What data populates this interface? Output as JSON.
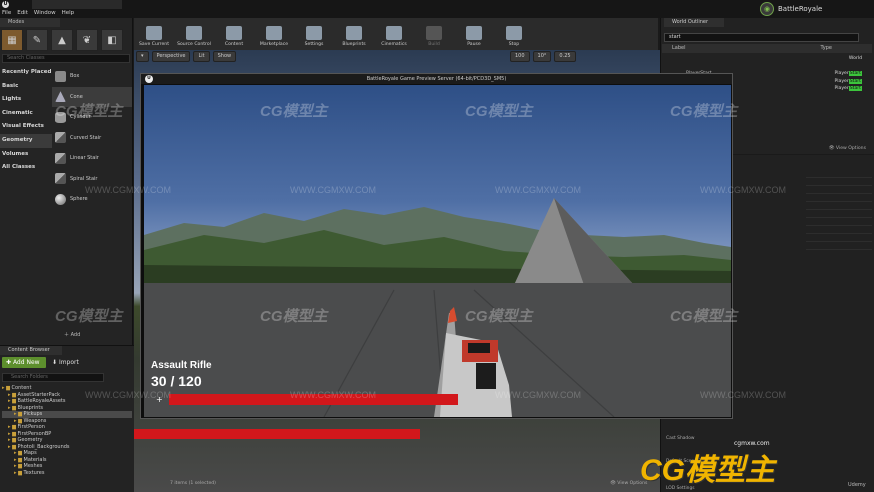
{
  "window": {
    "doc_tab": "",
    "menu": [
      "File",
      "Edit",
      "Window",
      "Help"
    ],
    "project_name": "BattleRoyale"
  },
  "modes": {
    "tab": "Modes",
    "search_placeholder": "Search Classes",
    "categories": [
      "Recently Placed",
      "Basic",
      "Lights",
      "Cinematic",
      "Visual Effects",
      "Geometry",
      "Volumes",
      "All Classes"
    ],
    "selected_category": "Geometry",
    "placeables": [
      "Box",
      "Cone",
      "Cylinder",
      "Curved Stair",
      "Linear Stair",
      "Spiral Stair",
      "Sphere"
    ],
    "selected_placeable": "Cone",
    "add_label": "Add"
  },
  "toolbar": {
    "items": [
      {
        "label": "Save Current",
        "icon": "save-icon"
      },
      {
        "label": "Source Control",
        "icon": "source-control-icon"
      },
      {
        "label": "Content",
        "icon": "content-icon"
      },
      {
        "label": "Marketplace",
        "icon": "marketplace-icon"
      },
      {
        "label": "Settings",
        "icon": "settings-icon"
      },
      {
        "label": "Blueprints",
        "icon": "blueprints-icon"
      },
      {
        "label": "Cinematics",
        "icon": "cinematics-icon"
      },
      {
        "label": "Build",
        "icon": "build-icon"
      },
      {
        "label": "Pause",
        "icon": "pause-icon"
      },
      {
        "label": "Stop",
        "icon": "stop-icon"
      }
    ]
  },
  "viewport": {
    "perspective": "Perspective",
    "lit": "Lit",
    "show": "Show",
    "snap_values": [
      "100",
      "10°",
      "0.25"
    ]
  },
  "outliner": {
    "tab": "World Outliner",
    "search_value": "start",
    "col_label": "Label",
    "col_type": "Type",
    "rows": [
      {
        "label": "",
        "type": "World",
        "indent": false
      },
      {
        "label": "",
        "type": "",
        "indent": false
      },
      {
        "label": "PlayerStart",
        "type": "PlayerStart",
        "indent": true
      },
      {
        "label": "",
        "type": "PlayerStart",
        "indent": true
      },
      {
        "label": "",
        "type": "PlayerStart",
        "indent": true
      }
    ],
    "view_options": "View Options"
  },
  "details": {
    "label_a": "Cast Shadow",
    "label_b": "Default Scene Root",
    "label_c": "LOD Settings",
    "credit": "Udemy"
  },
  "content_browser": {
    "tab": "Content Browser",
    "add_new": "Add New",
    "import": "Import",
    "search_placeholder": "Search Folders",
    "tree": [
      {
        "label": "Content",
        "level": 0,
        "selected": false
      },
      {
        "label": "AssetStarterPack",
        "level": 1,
        "selected": false
      },
      {
        "label": "BattleRoyaleAssets",
        "level": 1,
        "selected": false
      },
      {
        "label": "Blueprints",
        "level": 1,
        "selected": false
      },
      {
        "label": "Pickups",
        "level": 2,
        "selected": true
      },
      {
        "label": "Weapons",
        "level": 2,
        "selected": false
      },
      {
        "label": "FirstPerson",
        "level": 1,
        "selected": false
      },
      {
        "label": "FirstPersonBP",
        "level": 1,
        "selected": false
      },
      {
        "label": "Geometry",
        "level": 1,
        "selected": false
      },
      {
        "label": "Photoli_Backgrounds",
        "level": 1,
        "selected": false
      },
      {
        "label": "Maps",
        "level": 2,
        "selected": false
      },
      {
        "label": "Materials",
        "level": 2,
        "selected": false
      },
      {
        "label": "Meshes",
        "level": 2,
        "selected": false
      },
      {
        "label": "Textures",
        "level": 2,
        "selected": false
      }
    ],
    "status": "7 items (1 selected)",
    "view_options": "View Options"
  },
  "game_window": {
    "title": "BattleRoyale Game Preview Server (64-bit/PCD3D_SM5)",
    "weapon_name": "Assault Rifle",
    "ammo": "30 / 120",
    "health_fraction": 1.0,
    "cross": "+"
  },
  "background_hud": {
    "cross": "+",
    "health_fraction": 1.0
  },
  "watermark": {
    "brand": "CG模型主",
    "url": "WWW.CGMXW.COM",
    "corner_brand": "CG模型主",
    "corner_url": "cgmxw.com"
  },
  "colors": {
    "health": "#d2171b",
    "health_track": "#5e0b0b",
    "add_new_button": "#5d8f2d",
    "player_start_tag": "#3cc43c",
    "watermark_gold": "#f0b400"
  }
}
